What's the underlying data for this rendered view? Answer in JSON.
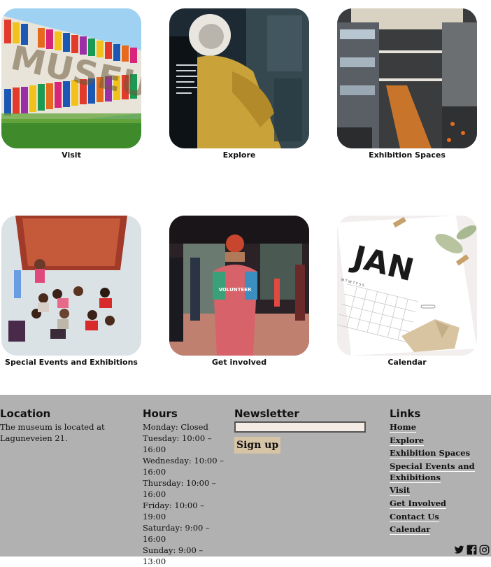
{
  "tiles": [
    {
      "label": "Visit"
    },
    {
      "label": "Explore"
    },
    {
      "label": "Exhibition Spaces"
    },
    {
      "label": "Special Events and Exhibitions"
    },
    {
      "label": "Get involved"
    },
    {
      "label": "Calendar"
    }
  ],
  "images": {
    "museum_sign": "MUSEUM",
    "volunteer_shirt": "VOLUNTEER",
    "calendar_month": "JAN",
    "calendar_weekdays": "M T W T F S S"
  },
  "footer": {
    "location": {
      "title": "Location",
      "text": "The museum is located at Laguneveien 21."
    },
    "hours": {
      "title": "Hours",
      "lines": [
        "Monday: Closed",
        "Tuesday: 10:00 –",
        "16:00",
        "Wednesday: 10:00 –",
        "16:00",
        "Thursday: 10:00 –",
        "16:00",
        "Friday: 10:00 – 19:00",
        "Saturday: 9:00 –",
        "16:00",
        "Sunday: 9:00 – 13:00"
      ]
    },
    "newsletter": {
      "title": "Newsletter",
      "input_value": "",
      "button": "Sign up"
    },
    "links": {
      "title": "Links",
      "items": [
        "Home",
        "Explore",
        "Exhibition Spaces",
        "Special Events and Exhibitions",
        "Visit",
        "Get Involved",
        "Contact Us",
        "Calendar"
      ]
    },
    "social": [
      "twitter-icon",
      "facebook-icon",
      "instagram-icon"
    ]
  },
  "colors": {
    "footer_bg": "#b1b1b2",
    "button_bg": "#d6c4a6",
    "input_bg": "#f3ebe4"
  }
}
